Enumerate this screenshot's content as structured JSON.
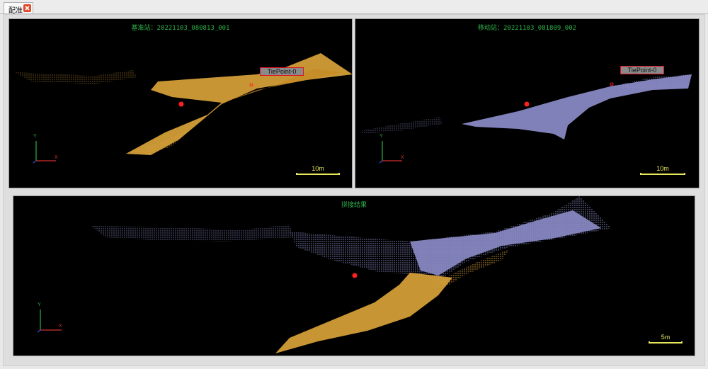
{
  "tab": {
    "label": "配准",
    "close_icon": "close-icon"
  },
  "colors": {
    "reference": "#d9a23a",
    "moving": "#8c8cc9",
    "title_green": "#2fb34a",
    "scale_yellow": "#e8e85a",
    "tiepoint_red": "#ff2020"
  },
  "views": {
    "reference": {
      "title": "基准站：20221103_080813_001",
      "tiepoint_label": "TiePoint-0",
      "scale_label": "10m"
    },
    "moving": {
      "title": "移动站：20221103_081809_002",
      "tiepoint_label": "TiePoint-0",
      "scale_label": "10m"
    },
    "result": {
      "title": "拼接结果",
      "scale_label": "5m"
    }
  },
  "axes": {
    "x_label": "X",
    "y_label": "Y"
  }
}
